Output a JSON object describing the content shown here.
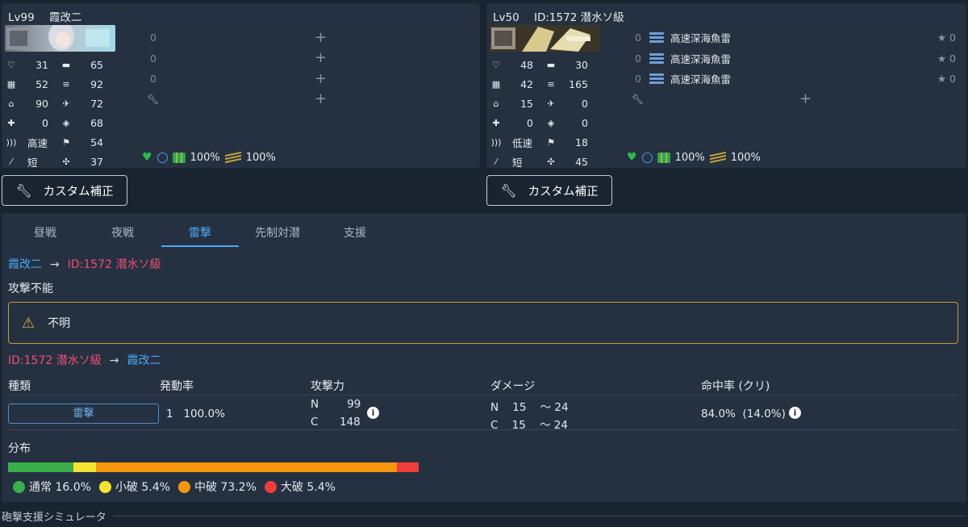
{
  "left_ship": {
    "level": "Lv99",
    "name": "霞改二",
    "stats": [
      {
        "icon": "hp-heart-icon",
        "value": "31"
      },
      {
        "icon": "firepower-gun-icon",
        "value": "65"
      },
      {
        "icon": "armor-icon",
        "value": "52"
      },
      {
        "icon": "torpedo-icon",
        "value": "92"
      },
      {
        "icon": "evasion-icon",
        "value": "90"
      },
      {
        "icon": "anti-air-icon",
        "value": "72"
      },
      {
        "icon": "aircraft-icon",
        "value": "0"
      },
      {
        "icon": "asw-icon",
        "value": "68"
      },
      {
        "icon": "speed-icon",
        "value": "高速"
      },
      {
        "icon": "los-icon",
        "value": "54"
      },
      {
        "icon": "range-icon",
        "value": "短"
      },
      {
        "icon": "luck-icon",
        "value": "37"
      }
    ],
    "slots": [
      {
        "count": "0"
      },
      {
        "count": "0"
      },
      {
        "count": "0"
      }
    ],
    "fuel": "100%",
    "ammo": "100%"
  },
  "right_ship": {
    "level": "Lv50",
    "name": "ID:1572 潜水ソ級",
    "stats": [
      {
        "icon": "hp-heart-icon",
        "value": "48"
      },
      {
        "icon": "firepower-gun-icon",
        "value": "30"
      },
      {
        "icon": "armor-icon",
        "value": "42"
      },
      {
        "icon": "torpedo-icon",
        "value": "165"
      },
      {
        "icon": "evasion-icon",
        "value": "15"
      },
      {
        "icon": "anti-air-icon",
        "value": "0"
      },
      {
        "icon": "aircraft-icon",
        "value": "0"
      },
      {
        "icon": "asw-icon",
        "value": "0"
      },
      {
        "icon": "speed-icon",
        "value": "低速"
      },
      {
        "icon": "los-icon",
        "value": "18"
      },
      {
        "icon": "range-icon",
        "value": "短"
      },
      {
        "icon": "luck-icon",
        "value": "45"
      }
    ],
    "slots": [
      {
        "count": "0",
        "name": "高速深海魚雷",
        "star": "0"
      },
      {
        "count": "0",
        "name": "高速深海魚雷",
        "star": "0"
      },
      {
        "count": "0",
        "name": "高速深海魚雷",
        "star": "0"
      }
    ],
    "fuel": "100%",
    "ammo": "100%"
  },
  "custom_button": "カスタム補正",
  "tabs": [
    "昼戦",
    "夜戦",
    "雷撃",
    "先制対潜",
    "支援"
  ],
  "active_tab": "雷撃",
  "route1": {
    "from": "霞改二",
    "to": "ID:1572 潜水ソ級"
  },
  "no_attack": "攻撃不能",
  "warning": "不明",
  "route2": {
    "from": "ID:1572 潜水ソ級",
    "to": "霞改二"
  },
  "table": {
    "headers": [
      "種類",
      "発動率",
      "攻撃力",
      "ダメージ",
      "命中率 (クリ)"
    ],
    "kind": "雷撃",
    "rate_num": "1",
    "rate": "100.0%",
    "power_n_label": "N",
    "power_n": "99",
    "power_c_label": "C",
    "power_c": "148",
    "dmg_n_label": "N",
    "dmg_n_min": "15",
    "dmg_n_max": "～ 24",
    "dmg_c_label": "C",
    "dmg_c_min": "15",
    "dmg_c_max": "～ 24",
    "hit": "84.0%",
    "crit": "(14.0%)"
  },
  "distribution": {
    "label": "分布",
    "items": [
      {
        "name": "通常 16.0%",
        "value": 16.0,
        "color": "#3aae4a"
      },
      {
        "name": "小破 5.4%",
        "value": 5.4,
        "color": "#f5e431"
      },
      {
        "name": "中破 73.2%",
        "value": 73.2,
        "color": "#f5960c"
      },
      {
        "name": "大破 5.4%",
        "value": 5.4,
        "color": "#ef3e3a"
      }
    ]
  },
  "footer": "砲撃支援シミュレータ"
}
